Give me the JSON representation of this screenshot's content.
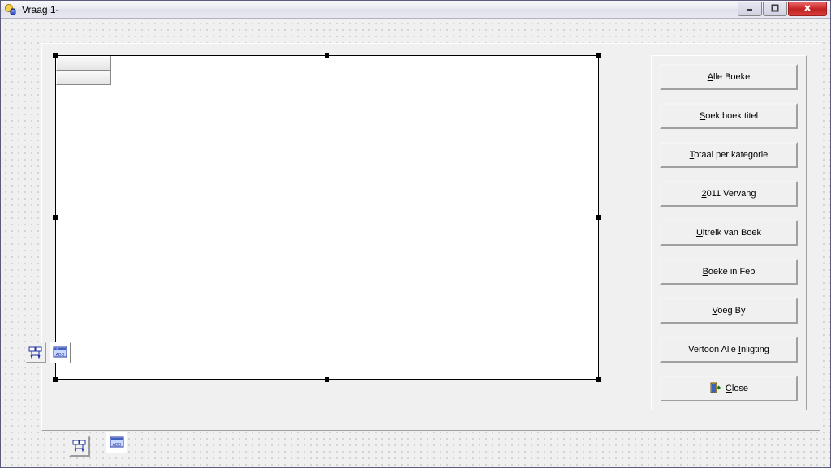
{
  "window": {
    "title": "Vraag 1-"
  },
  "buttons": {
    "b1": {
      "accel": "A",
      "rest": "lle Boeke"
    },
    "b2": {
      "accel": "S",
      "rest": "oek boek titel"
    },
    "b3": {
      "accel": "T",
      "rest": "otaal per kategorie"
    },
    "b4": {
      "accel": "2",
      "rest": "011 Vervang"
    },
    "b5": {
      "accel": "U",
      "rest": "itreik van Boek"
    },
    "b6": {
      "accel": "B",
      "rest": "oeke in Feb"
    },
    "b7": {
      "accel": "V",
      "rest": "oeg By"
    },
    "b8": {
      "pre": "Vertoon Alle ",
      "accel": "I",
      "rest": "nligting"
    },
    "b9": {
      "accel": "C",
      "rest": "lose"
    }
  },
  "tray": {
    "ado_label": "ADO"
  }
}
